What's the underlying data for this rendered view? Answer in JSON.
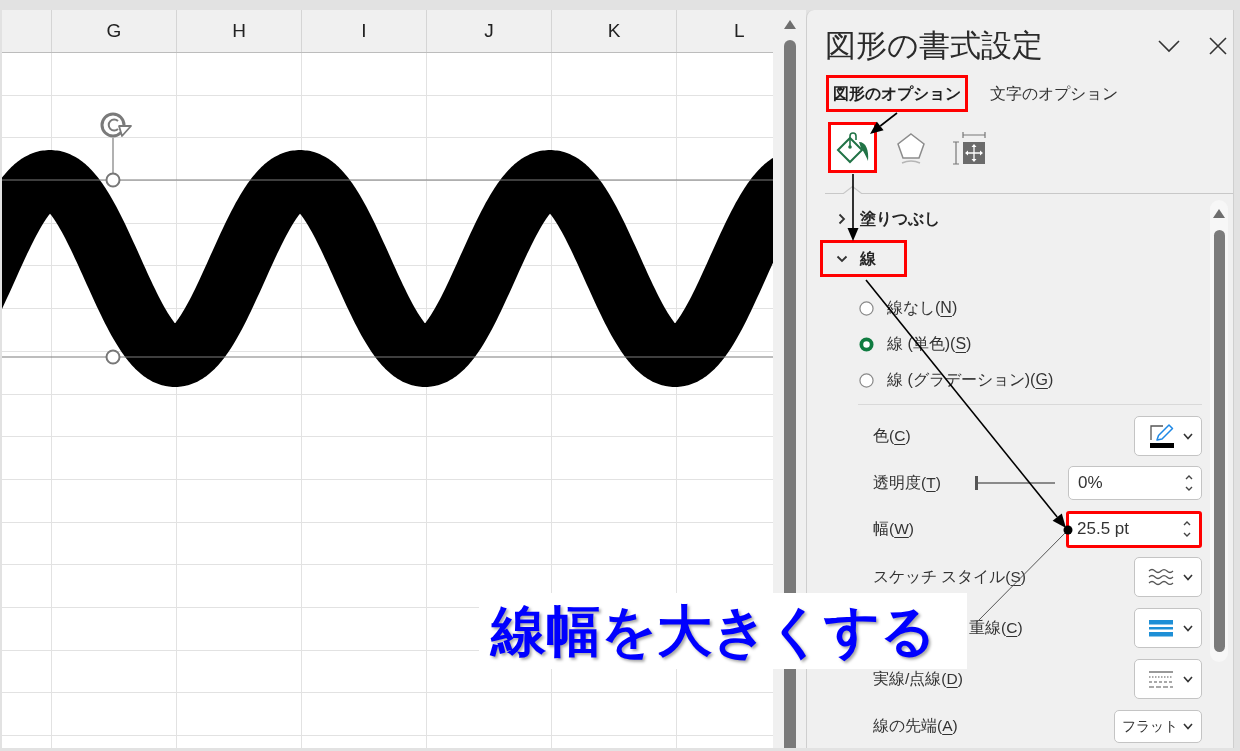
{
  "sheet": {
    "column_headers": [
      "G",
      "H",
      "I",
      "J",
      "K",
      "L"
    ]
  },
  "panel": {
    "title": "図形の書式設定",
    "tabs": [
      {
        "label": "図形のオプション",
        "selected": true,
        "highlighted": true
      },
      {
        "label": "文字のオプション",
        "selected": false,
        "highlighted": false
      }
    ],
    "category_icons": [
      {
        "kind": "fill",
        "selected": true,
        "highlighted": true
      },
      {
        "kind": "effects",
        "selected": false,
        "highlighted": false
      },
      {
        "kind": "size",
        "selected": false,
        "highlighted": false
      }
    ],
    "sections": [
      {
        "label": "塗りつぶし",
        "expanded": false,
        "highlighted": false
      },
      {
        "label": "線",
        "expanded": true,
        "highlighted": true,
        "options": [
          {
            "label": "線なし(N)",
            "selected": false
          },
          {
            "label": "線 (単色)(S)",
            "selected": true
          },
          {
            "label": "線 (グラデーション)(G)",
            "selected": false
          }
        ],
        "properties": [
          {
            "kind": "color",
            "label": "色(C)",
            "highlighted": false
          },
          {
            "kind": "transparency",
            "label": "透明度(T)",
            "level": 0,
            "value": "0%",
            "highlighted": false
          },
          {
            "kind": "width",
            "label": "幅(W)",
            "value": "25.5 pt",
            "highlighted": true
          },
          {
            "kind": "sketch",
            "label": "スケッチ スタイル(S)",
            "highlighted": false
          },
          {
            "kind": "compound",
            "label": "重線(C)",
            "highlighted": false
          },
          {
            "kind": "dash",
            "label": "実線/点線(D)",
            "highlighted": false
          },
          {
            "kind": "cap",
            "label": "線の先端(A)",
            "value": "フラット",
            "highlighted": false
          }
        ]
      }
    ]
  },
  "callout": {
    "text": "線幅を大きくする"
  }
}
